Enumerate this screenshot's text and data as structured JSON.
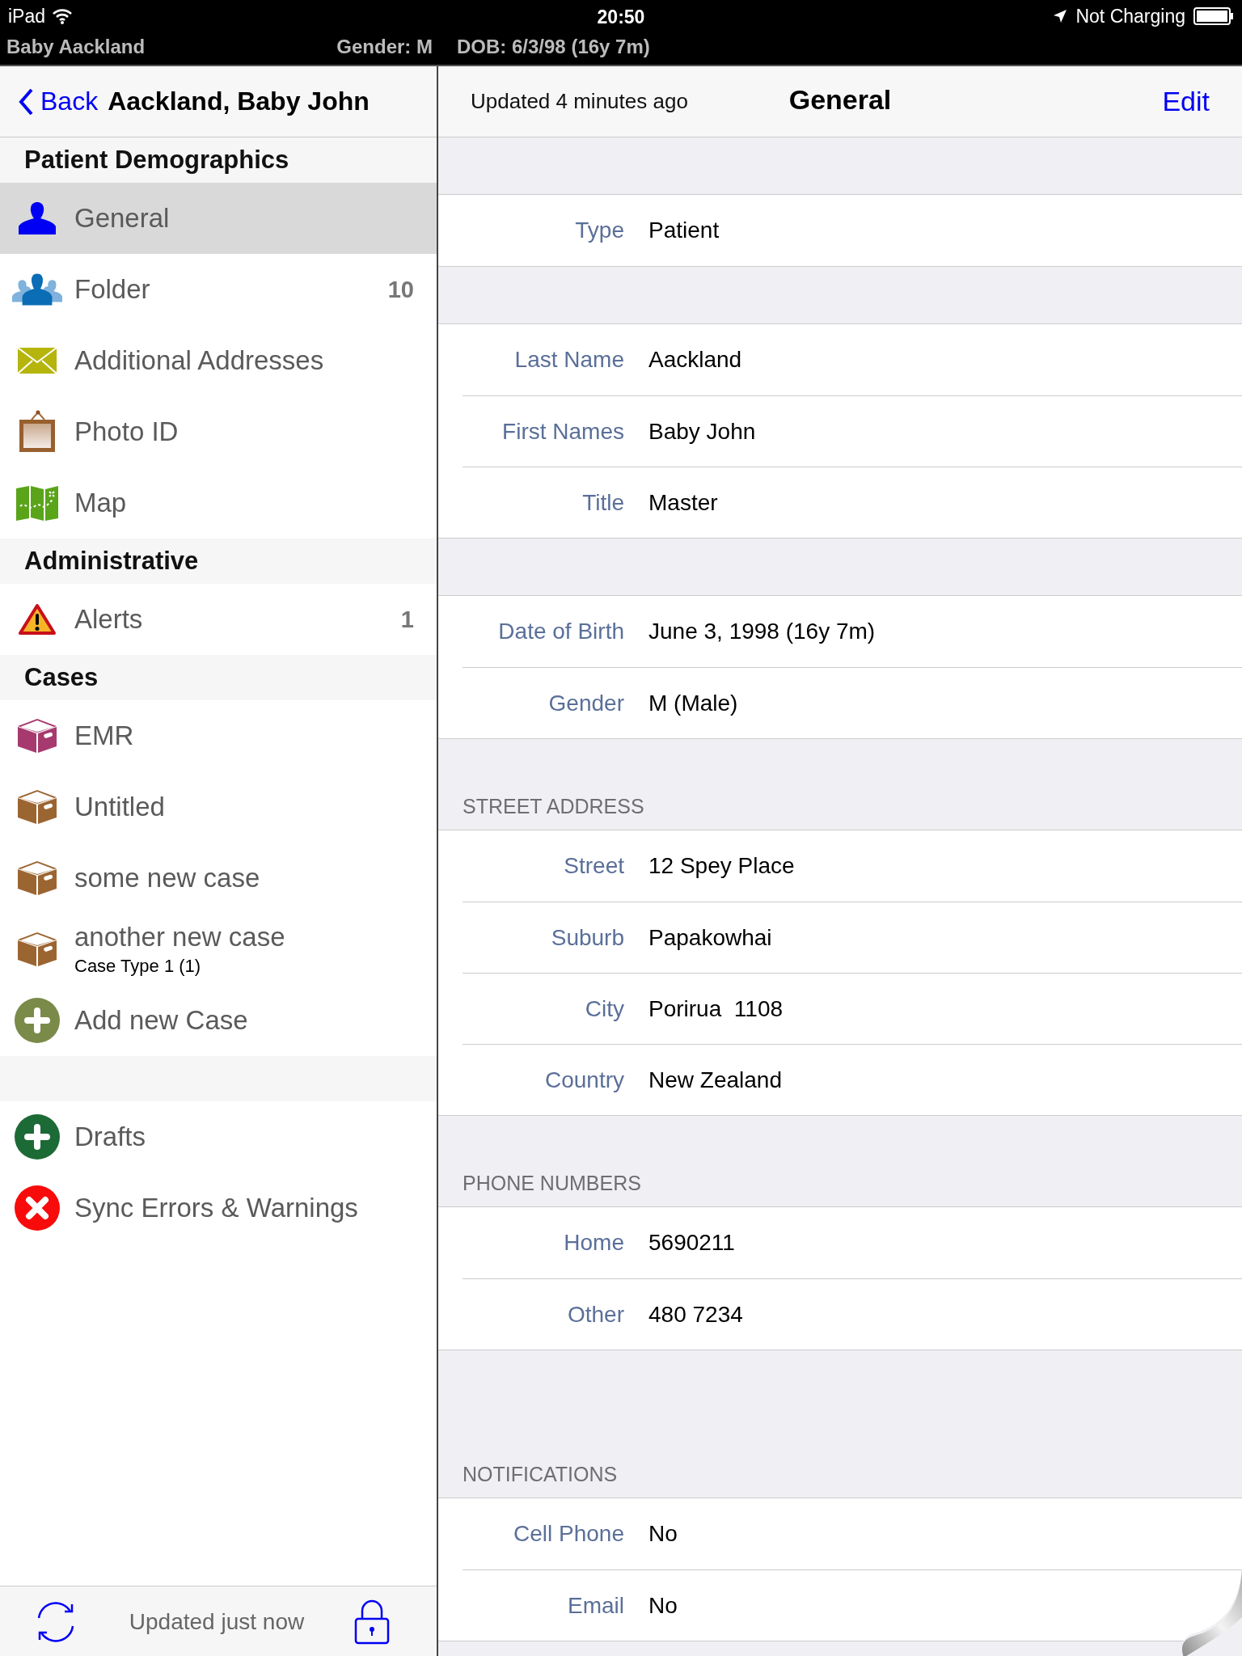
{
  "status_bar": {
    "device": "iPad",
    "time": "20:50",
    "battery_text": "Not Charging",
    "patient_name": "Baby Aackland",
    "gender": "Gender: M",
    "dob": "DOB: 6/3/98 (16y 7m)"
  },
  "nav": {
    "back": "Back",
    "patient": "Aackland, Baby John",
    "updated": "Updated 4 minutes ago",
    "title": "General",
    "edit": "Edit"
  },
  "sidebar": {
    "sections": [
      {
        "header": "Patient Demographics",
        "items": [
          {
            "label": "General",
            "kind": "person",
            "selected": true
          },
          {
            "label": "Folder",
            "kind": "people",
            "badge": "10",
            "selected": false
          },
          {
            "label": "Additional Addresses",
            "kind": "envelope",
            "selected": false
          },
          {
            "label": "Photo ID",
            "kind": "frame",
            "selected": false
          },
          {
            "label": "Map",
            "kind": "map",
            "selected": false
          }
        ]
      },
      {
        "header": "Administrative",
        "items": [
          {
            "label": "Alerts",
            "kind": "warning",
            "badge": "1",
            "selected": false
          }
        ]
      },
      {
        "header": "Cases",
        "items": [
          {
            "label": "EMR",
            "kind": "box",
            "color": "#a63a6e",
            "selected": false
          },
          {
            "label": "Untitled",
            "kind": "box",
            "color": "#9b6532",
            "selected": false
          },
          {
            "label": "some new case",
            "kind": "box",
            "color": "#9b6532",
            "selected": false
          },
          {
            "label": "another new case",
            "subtitle": "Case Type 1 (1)",
            "kind": "box",
            "color": "#9b6532",
            "selected": false
          },
          {
            "label": "Add new Case",
            "kind": "plus",
            "color": "#7a8a49",
            "selected": false
          }
        ]
      },
      {
        "items": [
          {
            "label": "Drafts",
            "kind": "plus",
            "color": "#1c6a35",
            "selected": false
          },
          {
            "label": "Sync Errors & Warnings",
            "kind": "error",
            "selected": false
          }
        ]
      }
    ],
    "footer": "Updated just now"
  },
  "detail": {
    "groups": [
      {
        "rows": [
          {
            "label": "Type",
            "value": "Patient"
          }
        ]
      },
      {
        "rows": [
          {
            "label": "Last Name",
            "value": "Aackland"
          },
          {
            "label": "First Names",
            "value": "Baby John"
          },
          {
            "label": "Title",
            "value": "Master"
          }
        ]
      },
      {
        "rows": [
          {
            "label": "Date of Birth",
            "value": "June 3, 1998 (16y 7m)"
          },
          {
            "label": "Gender",
            "value": "M (Male)"
          }
        ]
      },
      {
        "header": "STREET ADDRESS",
        "rows": [
          {
            "label": "Street",
            "value": "12 Spey Place"
          },
          {
            "label": "Suburb",
            "value": "Papakowhai"
          },
          {
            "label": "City",
            "value": "Porirua  1108"
          },
          {
            "label": "Country",
            "value": "New Zealand"
          }
        ]
      },
      {
        "header": "PHONE NUMBERS",
        "rows": [
          {
            "label": "Home",
            "value": "5690211"
          },
          {
            "label": "Other",
            "value": "480 7234"
          }
        ]
      },
      {
        "header": "NOTIFICATIONS",
        "rows": [
          {
            "label": "Cell Phone",
            "value": "No"
          },
          {
            "label": "Email",
            "value": "No"
          }
        ]
      }
    ]
  }
}
